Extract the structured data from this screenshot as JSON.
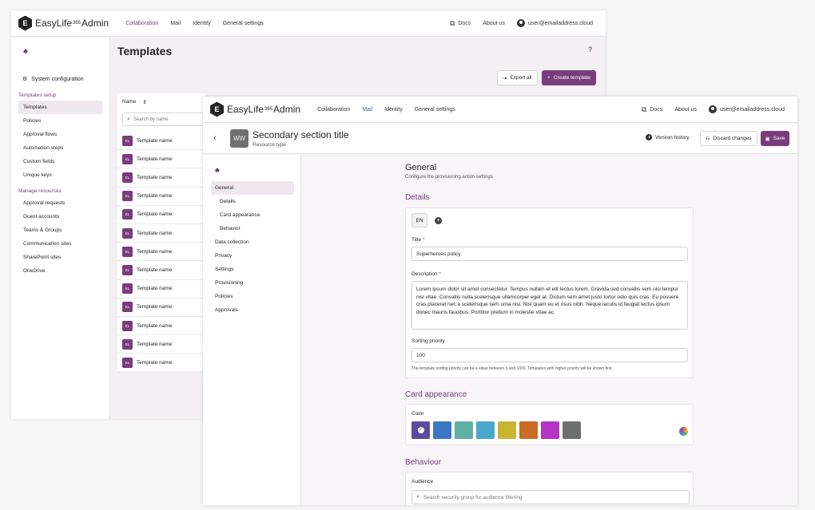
{
  "back_window": {
    "brand": {
      "logo_letter": "E",
      "name": "EasyLife",
      "version": "365",
      "suffix": "Admin"
    },
    "nav": [
      "Collaboration",
      "Mail",
      "Identity",
      "General settings"
    ],
    "active_nav": "Collaboration",
    "top_right": {
      "docs": "Docs",
      "about": "About us",
      "user": "user@emailaddress.cloud"
    },
    "sidebar": {
      "system_config": "System configuration",
      "templates_setup_label": "Templates setup",
      "setup_items": [
        "Templates",
        "Policies",
        "Approval flows",
        "Automation steps",
        "Custom fields",
        "Unique keys"
      ],
      "manage_label": "Manage resources",
      "manage_items": [
        "Approval requests",
        "Guest accounts",
        "Teams & Groups",
        "Communication sites",
        "SharePoint sites",
        "OneDrive"
      ]
    },
    "page_title": "Templates",
    "help": "?",
    "export_label": "Export all",
    "create_label": "Create template",
    "list": {
      "column_header": "Name",
      "search_placeholder": "Search by name",
      "badge": "EL",
      "rows": [
        "Template name",
        "Template name",
        "Template name",
        "Template name",
        "Template name",
        "Template name",
        "Template name",
        "Template name",
        "Template name",
        "Template name",
        "Template name",
        "Template name",
        "Template name"
      ]
    }
  },
  "front_window": {
    "brand": {
      "logo_letter": "E",
      "name": "EasyLife",
      "version": "365",
      "suffix": "Admin"
    },
    "nav": [
      "Collaboration",
      "Mail",
      "Identity",
      "General settings"
    ],
    "active_nav": "Mail",
    "top_right": {
      "docs": "Docs",
      "about": "About us",
      "user": "user@emailaddress.cloud"
    },
    "header": {
      "avatar_initials": "WW",
      "title": "Secondary section title",
      "subtitle": "Resource type",
      "version_history": "Version history",
      "discard": "Discard changes",
      "save": "Save"
    },
    "sub_nav": {
      "general": "General",
      "general_children": [
        "Details",
        "Card appearance",
        "Behavior"
      ],
      "items": [
        "Data collection",
        "Privacy",
        "Settings",
        "Provisioning",
        "Policies",
        "Approvals"
      ]
    },
    "content": {
      "title": "General",
      "subtitle": "Configure the provisioning action settings",
      "details_heading": "Details",
      "lang": "EN",
      "title_label": "Title",
      "title_value": "Superheroes policy",
      "description_label": "Description",
      "description_value": "Lorem ipsum dolor sit amet consectetur. Tempus nullam et elit lectus lorem. Gravida sed convallis sem nisi tempor nisi vitae. Convallis nulla scelerisque ullamcorper eget at. Dictum sem amet justo tortor odio quis cras. Eu posuere cras placerat nec a scelerisque sem urna nisi. Nisl quam eu et risus nibh. Neque iaculis id feugiat lectus ipsum donec mauris faucibus. Porttitor pretium in molestie vitae ac.",
      "sorting_label": "Sorting priority",
      "sorting_value": "100",
      "sorting_hint": "The template sorting priority can be a value between 0 and 1000. Templates with higher priority will be shown first",
      "card_heading": "Card appearance",
      "color_label": "Color",
      "colors": [
        "#5b4a9e",
        "#3a78c6",
        "#5fb0a3",
        "#4aa7c9",
        "#c8b633",
        "#c96c24",
        "#b434c4",
        "#6e6e6e"
      ],
      "selected_color": 0,
      "behaviour_heading": "Behaviour",
      "audience_label": "Audience",
      "audience_placeholder": "Search security group for audience filtering"
    }
  }
}
